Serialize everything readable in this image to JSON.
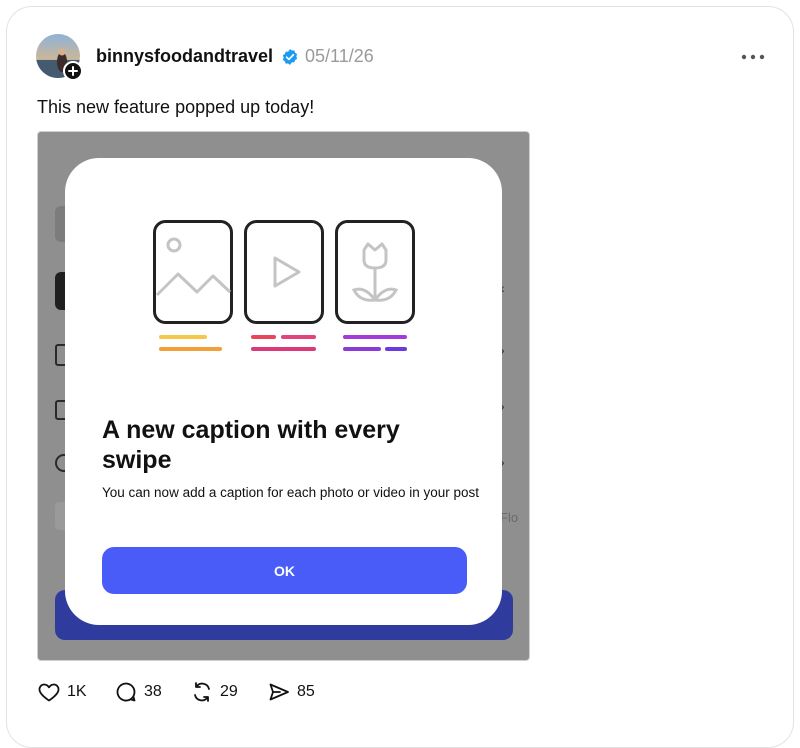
{
  "post": {
    "username": "binnysfoodandtravel",
    "date": "05/11/26",
    "caption": "This new feature popped up today!"
  },
  "media": {
    "background_text_partial": "Flo",
    "modal": {
      "title": "A new caption with every swipe",
      "description": "You can now add a caption for each photo or video in your post",
      "ok_label": "OK",
      "accent_colors": {
        "yellow": "#f5c84a",
        "orange": "#f08a2a",
        "red": "#e8445a",
        "pink": "#d93a7a",
        "purple": "#8a3ad9",
        "violet": "#6a3ae0"
      },
      "button_color": "#4a5cf7"
    }
  },
  "actions": {
    "likes": "1K",
    "comments": "38",
    "reposts": "29",
    "shares": "85"
  },
  "colors": {
    "verified": "#1d9bf0",
    "date": "#9a9a9a"
  }
}
